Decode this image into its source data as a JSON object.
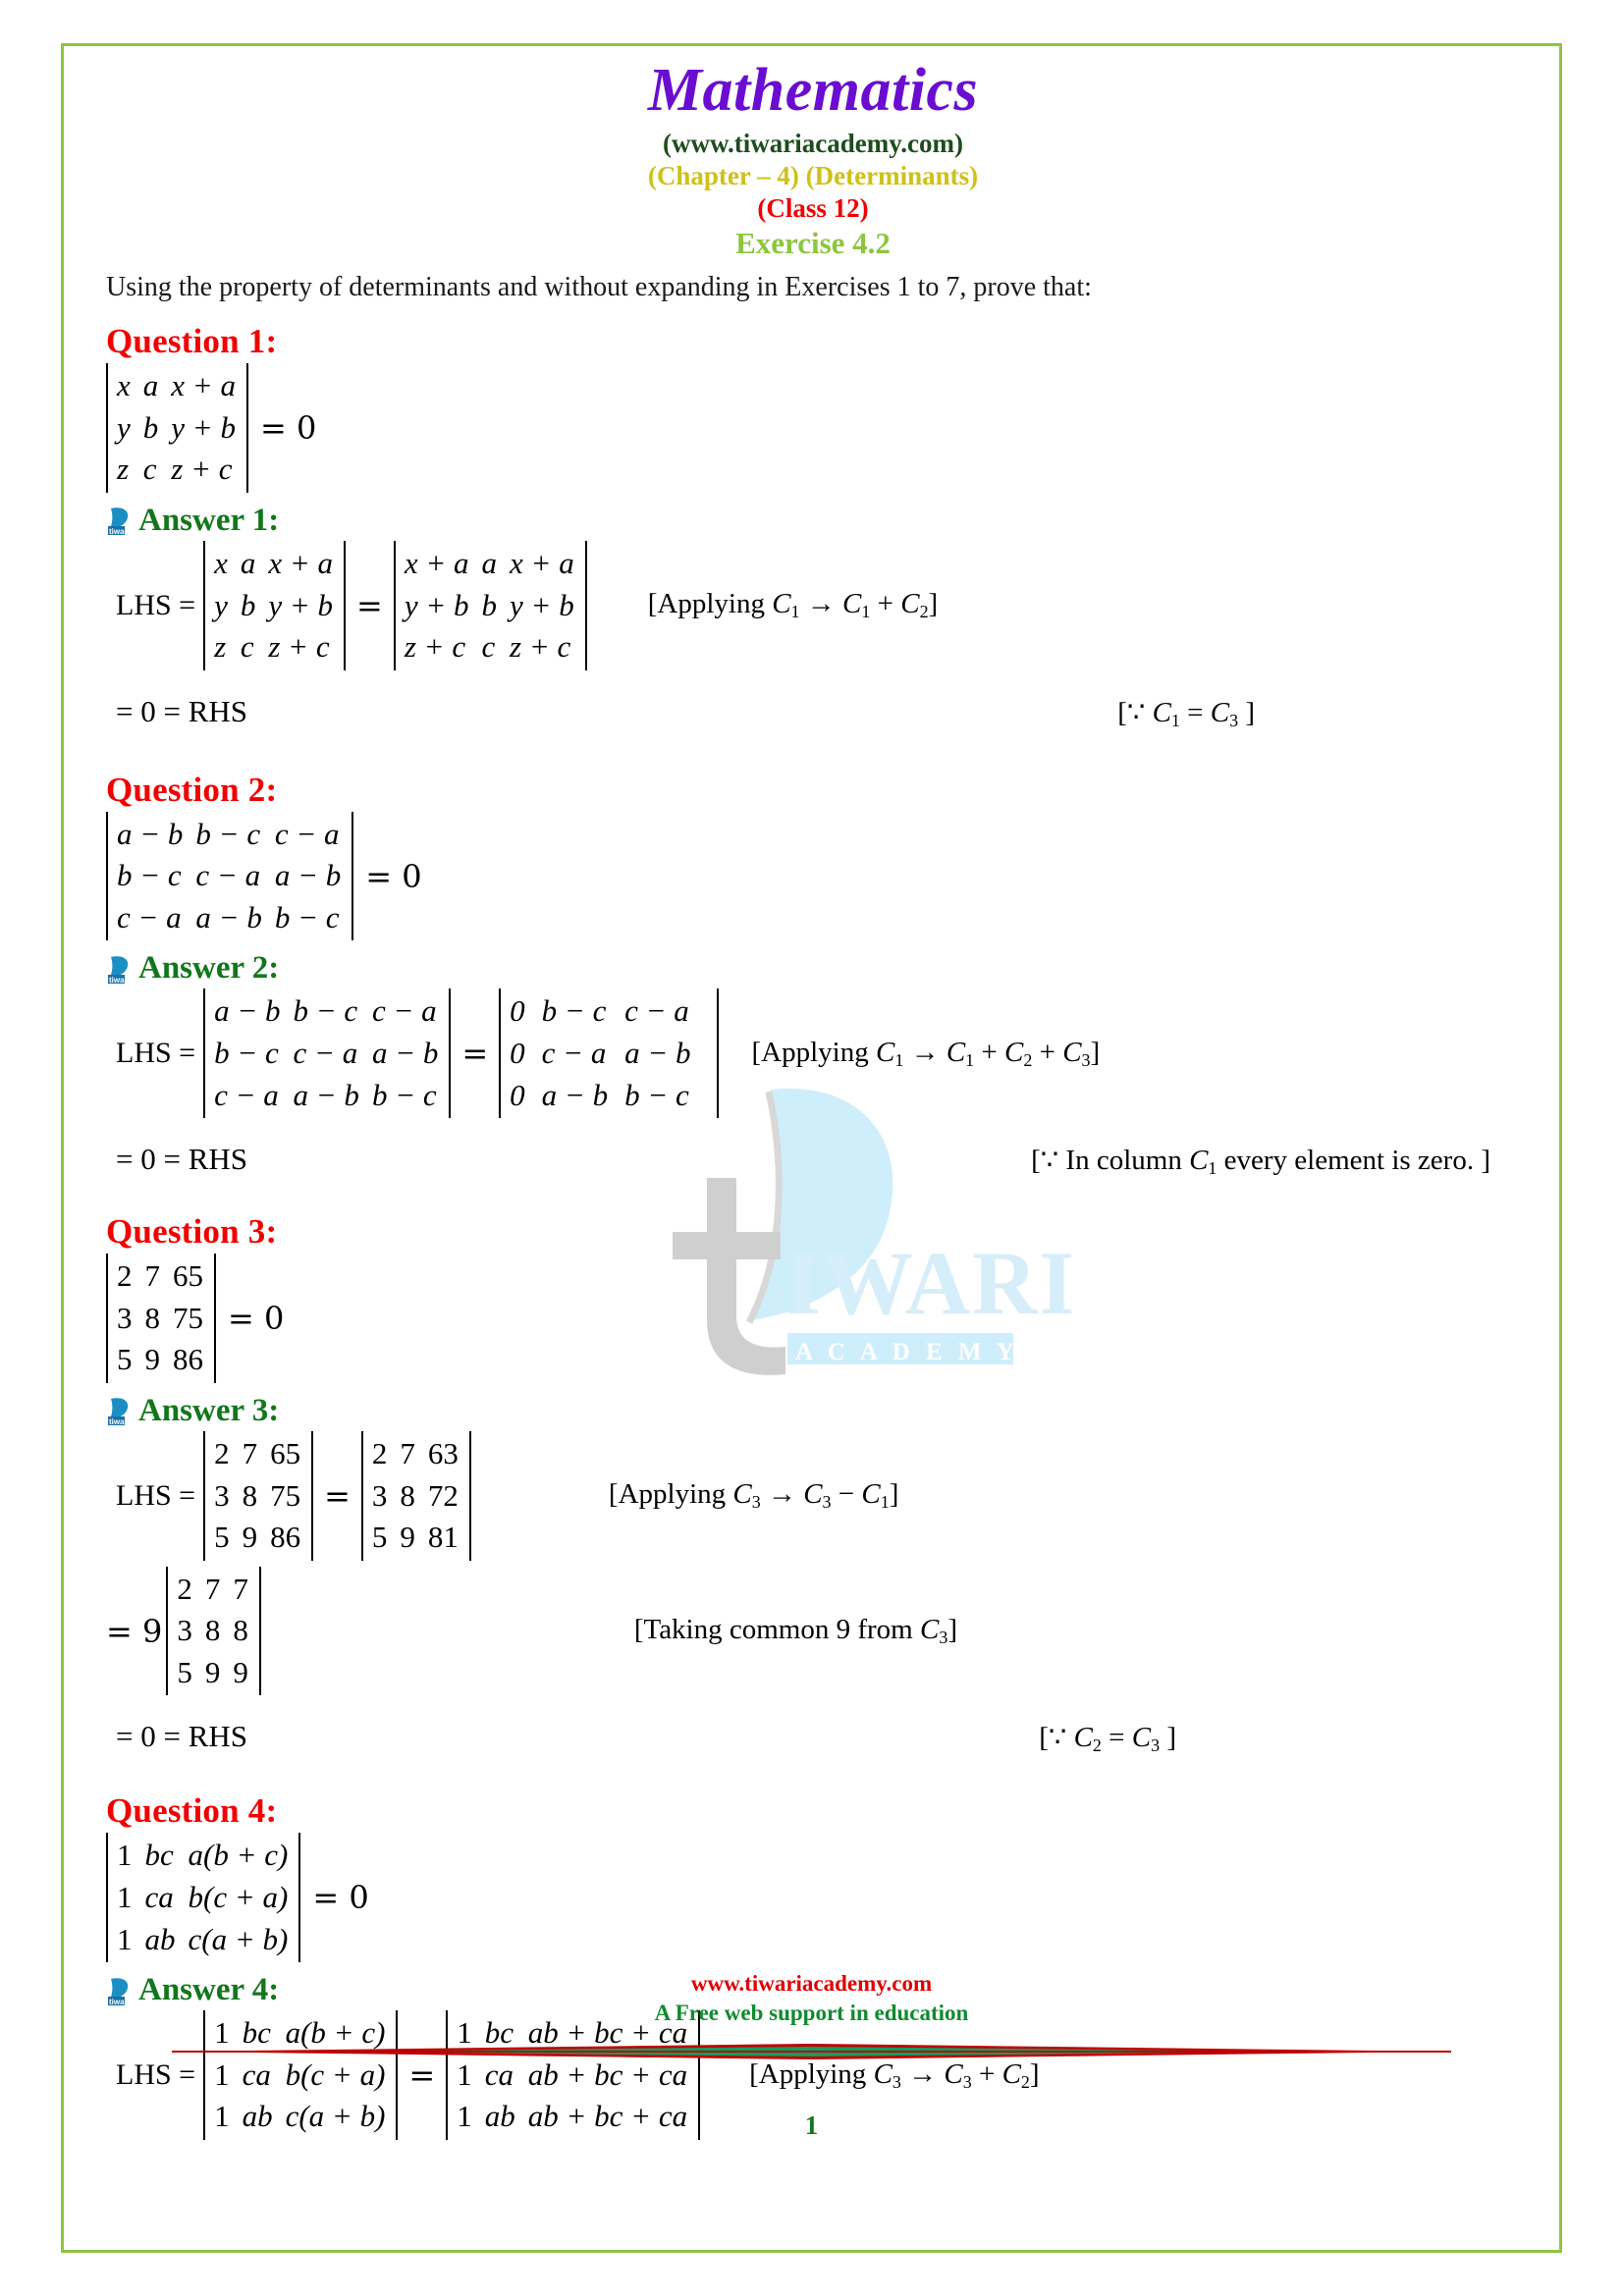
{
  "header": {
    "title": "Mathematics",
    "site": "(www.tiwariacademy.com)",
    "chapter": "(Chapter – 4) (Determinants)",
    "klass": "(Class 12)",
    "exercise": "Exercise 4.2"
  },
  "intro": "Using the property of determinants and without expanding in Exercises 1 to 7, prove that:",
  "colors": {
    "title": "#6a0dd0",
    "site": "#1d4d1d",
    "chapter": "#cfc01a",
    "class": "#f20000",
    "exercise": "#8cc63f",
    "question": "#f20000",
    "answer": "#11771b",
    "border": "#8cc63f",
    "footer_url": "#e00000",
    "footer_tag": "#0f8b2e"
  },
  "labels": {
    "lhs": "LHS =",
    "equals": "=",
    "zero": "0",
    "rhs_line": "= 0 = RHS"
  },
  "questions": [
    {
      "heading": "Question 1:",
      "answer_heading": "Answer 1:",
      "matrix": [
        [
          "x",
          "a",
          "x + a"
        ],
        [
          "y",
          "b",
          "y + b"
        ],
        [
          "z",
          "c",
          "z + c"
        ]
      ],
      "result": "= 0",
      "step_matrix": [
        [
          "x + a",
          "a",
          "x + a"
        ],
        [
          "y + b",
          "b",
          "y + b"
        ],
        [
          "z + c",
          "c",
          "z + c"
        ]
      ],
      "note": "[Applying C1 → C1 + C2]",
      "note_parts": [
        "[Applying ",
        "C",
        "1",
        " → ",
        "C",
        "1",
        " + ",
        "C",
        "2",
        "]"
      ],
      "conclusion": "= 0 = RHS",
      "reason": "[∵ C1 = C3 ]"
    },
    {
      "heading": "Question 2:",
      "answer_heading": "Answer 2:",
      "matrix": [
        [
          "a − b",
          "b − c",
          "c − a"
        ],
        [
          "b − c",
          "c − a",
          "a − b"
        ],
        [
          "c − a",
          "a − b",
          "b − c"
        ]
      ],
      "result": "= 0",
      "step_matrix": [
        [
          "0",
          "b − c",
          "c − a"
        ],
        [
          "0",
          "c − a",
          "a − b"
        ],
        [
          "0",
          "a − b",
          "b − c"
        ]
      ],
      "note": "[Applying C1 → C1 + C2 + C3]",
      "conclusion": "= 0 = RHS",
      "reason": "[∵ In column C1 every element is zero. ]"
    },
    {
      "heading": "Question 3:",
      "answer_heading": "Answer 3:",
      "matrix": [
        [
          "2",
          "7",
          "65"
        ],
        [
          "3",
          "8",
          "75"
        ],
        [
          "5",
          "9",
          "86"
        ]
      ],
      "result": "= 0",
      "step_matrix": [
        [
          "2",
          "7",
          "63"
        ],
        [
          "3",
          "8",
          "72"
        ],
        [
          "5",
          "9",
          "81"
        ]
      ],
      "note": "[Applying C3 → C3 − C1]",
      "step2_coefficient": "= 9",
      "step2_matrix": [
        [
          "2",
          "7",
          "7"
        ],
        [
          "3",
          "8",
          "8"
        ],
        [
          "5",
          "9",
          "9"
        ]
      ],
      "note2": "[Taking common 9 from C3]",
      "conclusion": "= 0 = RHS",
      "reason": "[∵ C2 = C3 ]"
    },
    {
      "heading": "Question 4:",
      "answer_heading": "Answer 4:",
      "matrix": [
        [
          "1",
          "bc",
          "a(b + c)"
        ],
        [
          "1",
          "ca",
          "b(c + a)"
        ],
        [
          "1",
          "ab",
          "c(a + b)"
        ]
      ],
      "result": "= 0",
      "step_matrix": [
        [
          "1",
          "bc",
          "ab + bc + ca"
        ],
        [
          "1",
          "ca",
          "ab + bc + ca"
        ],
        [
          "1",
          "ab",
          "ab + bc + ca"
        ]
      ],
      "note": "[Applying C3 → C3 + C2]"
    }
  ],
  "watermark": {
    "brand": "IWARI",
    "sub": "A C A D E M Y"
  },
  "footer": {
    "url": "www.tiwariacademy.com",
    "tagline": "A Free web support in education",
    "page": "1"
  }
}
